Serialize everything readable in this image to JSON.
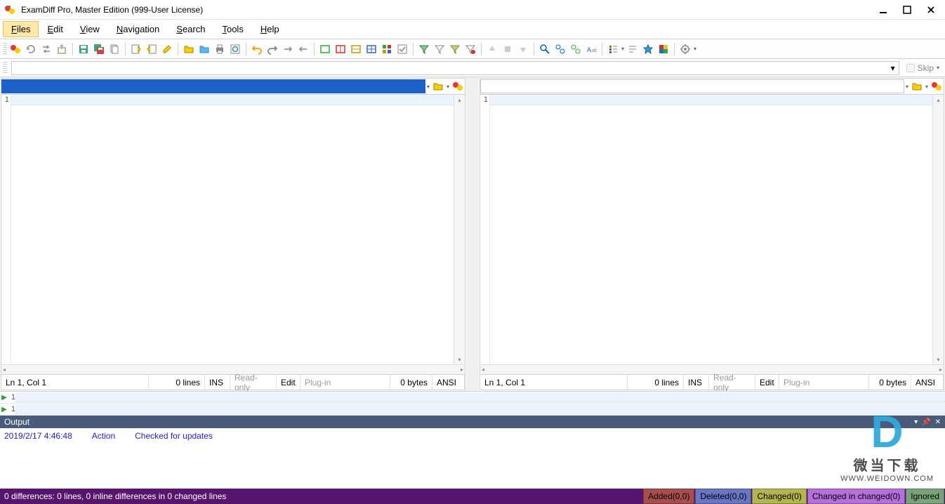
{
  "title": "ExamDiff Pro, Master Edition (999-User License)",
  "menu": {
    "files": "Files",
    "edit": "Edit",
    "view": "View",
    "navigation": "Navigation",
    "search": "Search",
    "tools": "Tools",
    "help": "Help"
  },
  "combobar": {
    "skip": "Skip"
  },
  "panes": {
    "left": {
      "line_num": "1",
      "status": {
        "ln": "Ln 1, Col 1",
        "lines": "0 lines",
        "ins": "INS",
        "ro": "Read-only",
        "edit": "Edit",
        "plugin": "Plug-in",
        "bytes": "0 bytes",
        "enc": "ANSI"
      }
    },
    "right": {
      "line_num": "1",
      "status": {
        "ln": "Ln 1, Col 1",
        "lines": "0 lines",
        "ins": "INS",
        "ro": "Read-only",
        "edit": "Edit",
        "plugin": "Plug-in",
        "bytes": "0 bytes",
        "enc": "ANSI"
      }
    }
  },
  "minirows": {
    "n1": "1",
    "n2": "1"
  },
  "output": {
    "title": "Output",
    "timestamp": "2019/2/17 4:46:48",
    "action_label": "Action",
    "message": "Checked for updates"
  },
  "statusbar": {
    "msg": "0 differences: 0 lines, 0 inline differences in 0 changed lines",
    "added": "Added(0,0)",
    "deleted": "Deleted(0,0)",
    "changed": "Changed(0)",
    "cic": "Changed in changed(0)",
    "ignored": "Ignored"
  },
  "watermark": {
    "cn": "微当下载",
    "url": "WWW.WEIDOWN.COM"
  },
  "colors": {
    "title_active": "#1a61c9",
    "status_bg": "#58156e"
  }
}
